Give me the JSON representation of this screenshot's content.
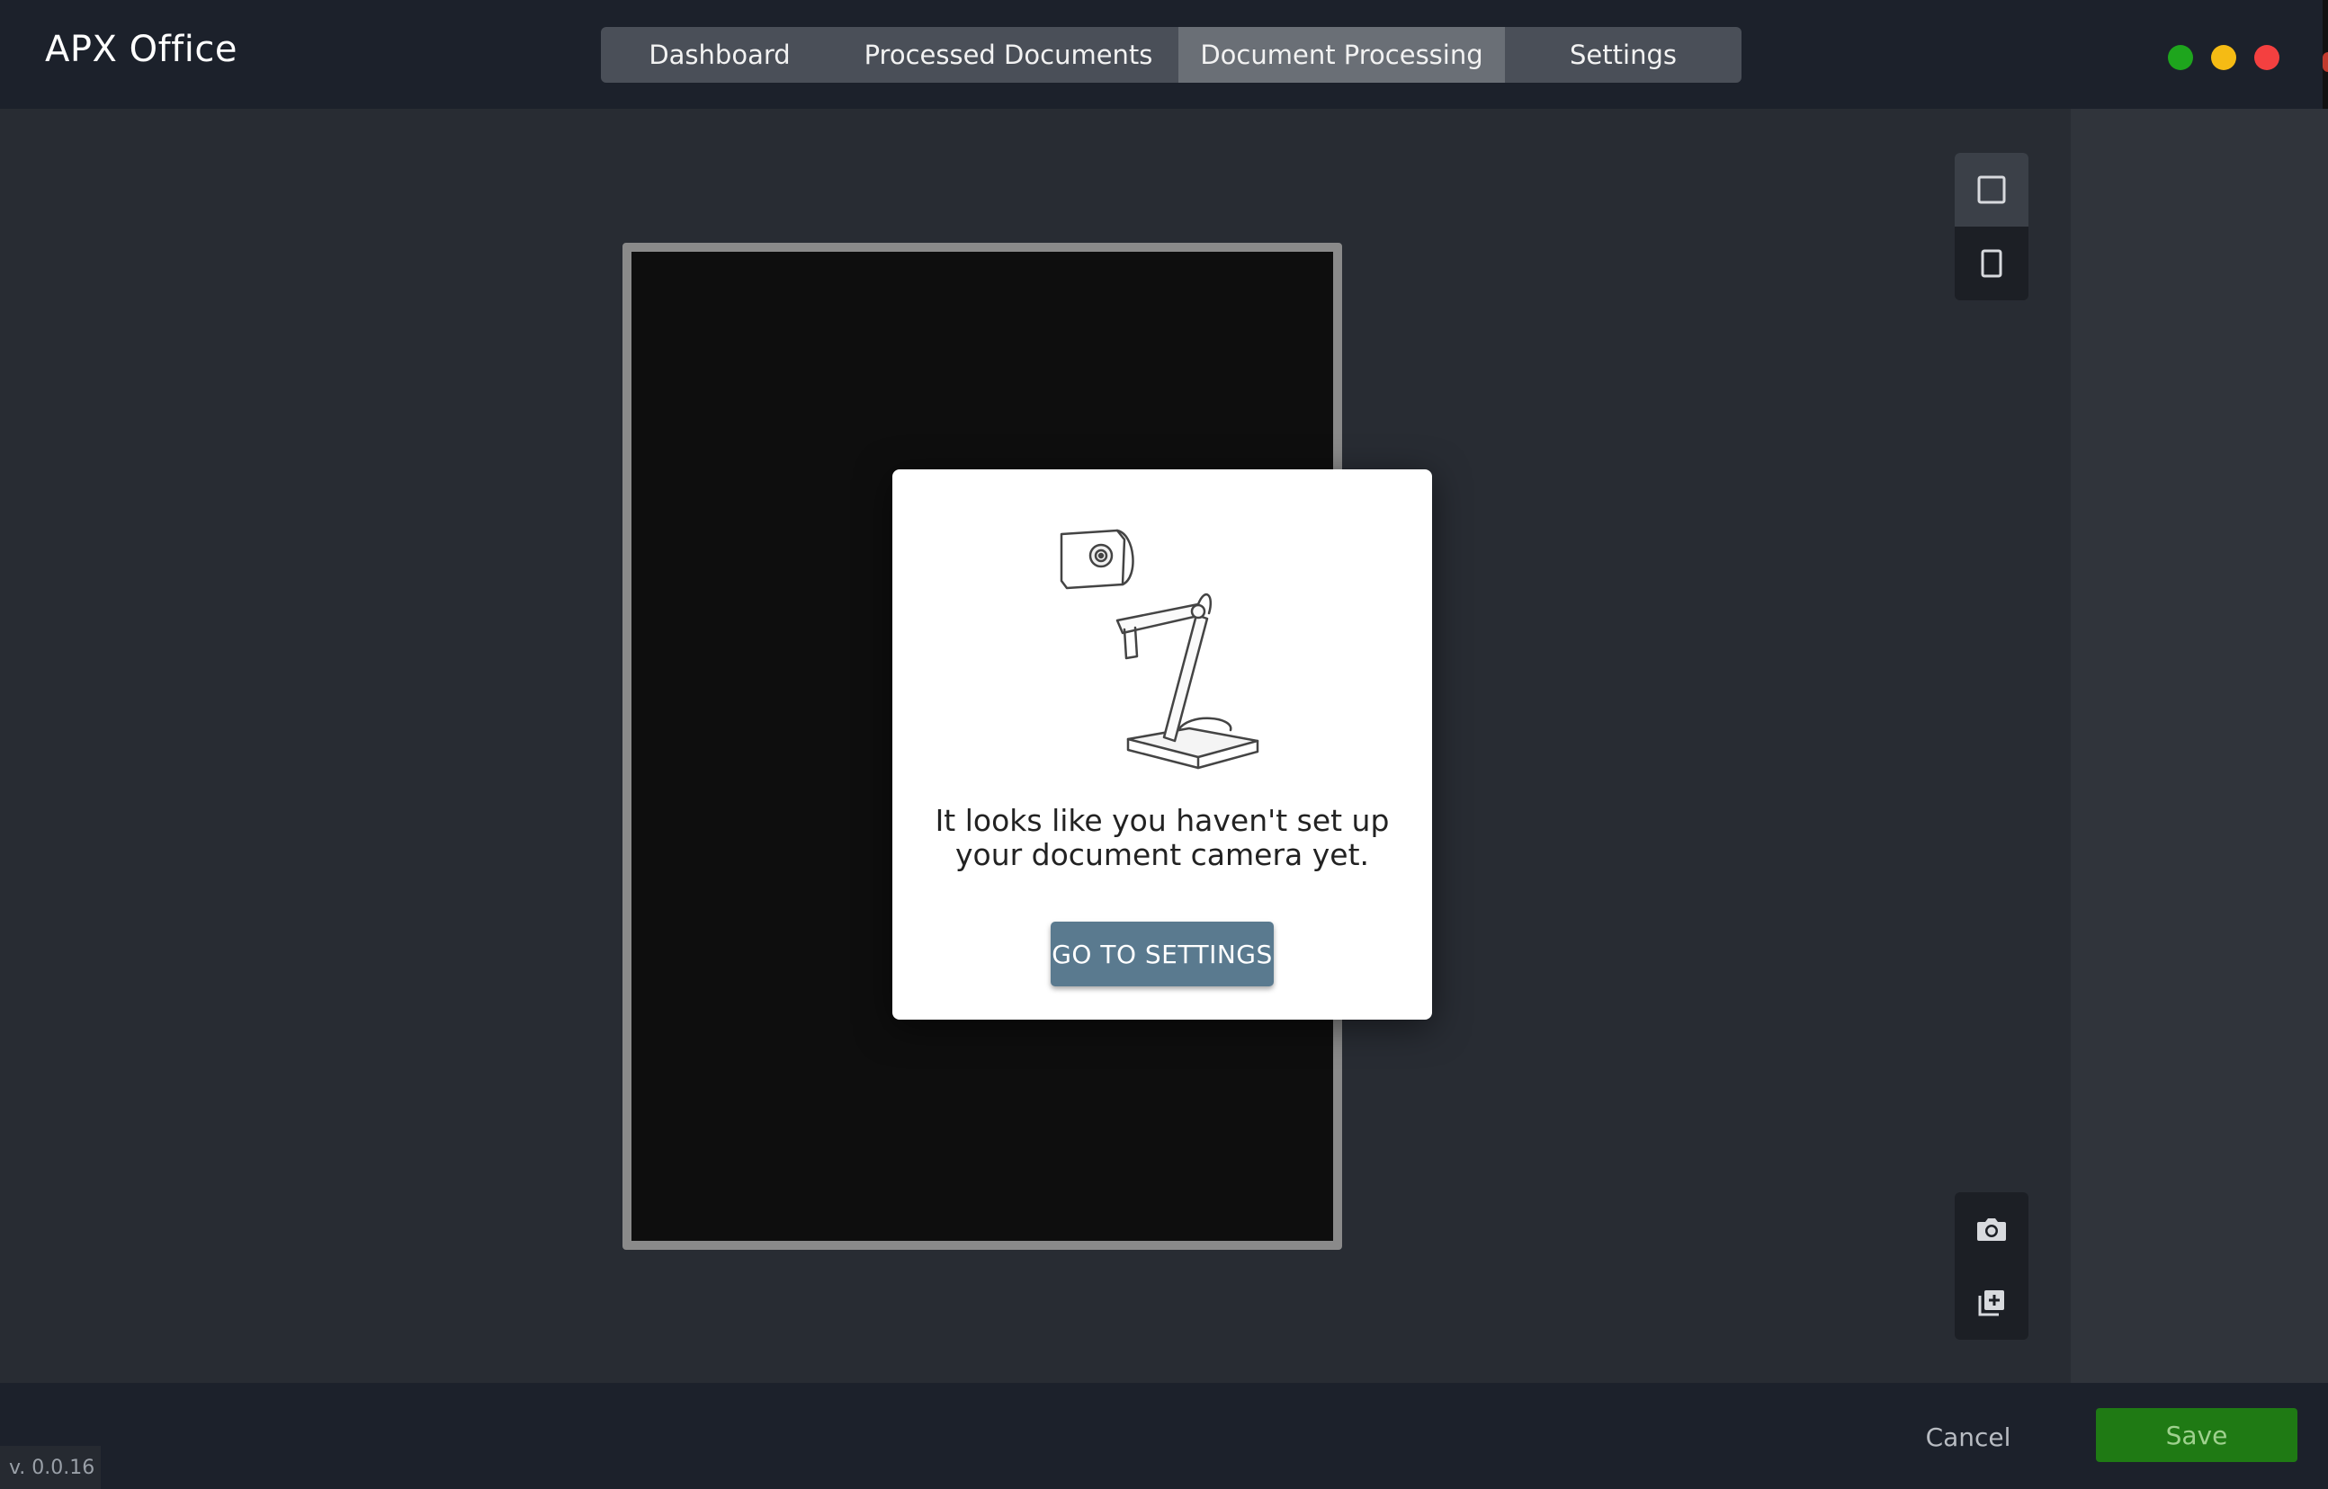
{
  "app": {
    "title": "APX Office"
  },
  "tabs": [
    {
      "label": "Dashboard"
    },
    {
      "label": "Processed Documents"
    },
    {
      "label": "Document Processing",
      "active": true
    },
    {
      "label": "Settings"
    }
  ],
  "window_controls": {
    "icons": [
      "maximize-dot",
      "minimize-dot",
      "close-dot"
    ],
    "colors": {
      "green": "#1ea51d",
      "yellow": "#f5bb14",
      "red": "#f44040"
    }
  },
  "toolbar": {
    "orientation": [
      {
        "icon": "square-frame-icon",
        "active": true
      },
      {
        "icon": "portrait-frame-icon",
        "active": false
      }
    ],
    "actions": [
      {
        "icon": "camera-icon"
      },
      {
        "icon": "add-page-icon"
      }
    ]
  },
  "modal": {
    "line1": "It looks like you haven't set up",
    "line2": "your document camera yet.",
    "button": "GO TO SETTINGS",
    "illustration": "document-camera-illustration"
  },
  "footer": {
    "cancel": "Cancel",
    "save": "Save",
    "version": "v. 0.0.16",
    "save_color": "#1f7a14"
  }
}
